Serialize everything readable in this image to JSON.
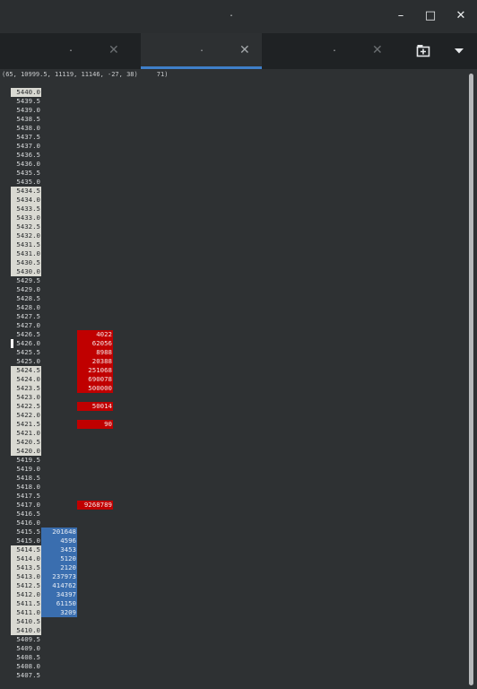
{
  "window": {
    "title": ".",
    "buttons": {
      "minimize": "–",
      "maximize": "□",
      "close": "✕"
    }
  },
  "tabs": [
    {
      "label": ".",
      "close": "✕",
      "active": false
    },
    {
      "label": ".",
      "close": "✕",
      "active": true
    },
    {
      "label": ".",
      "close": "✕",
      "active": false
    }
  ],
  "toolbar": {
    "new_tab_icon": "new-tab-icon",
    "menu_icon": "chevron-down-icon"
  },
  "status_text": "(65, 10999.5, 11119, 11146, -27, 38)     71)",
  "colors": {
    "accent": "#3f7fc9",
    "bid": "#3a6eaf",
    "ask": "#c00000",
    "highlight": "#d9d9d2"
  },
  "ladder": {
    "prices": [
      "5440.0",
      "5439.5",
      "5439.0",
      "5438.5",
      "5438.0",
      "5437.5",
      "5437.0",
      "5436.5",
      "5436.0",
      "5435.5",
      "5435.0",
      "5434.5",
      "5434.0",
      "5433.5",
      "5433.0",
      "5432.5",
      "5432.0",
      "5431.5",
      "5431.0",
      "5430.5",
      "5430.0",
      "5429.5",
      "5429.0",
      "5428.5",
      "5428.0",
      "5427.5",
      "5427.0",
      "5426.5",
      "5426.0",
      "5425.5",
      "5425.0",
      "5424.5",
      "5424.0",
      "5423.5",
      "5423.0",
      "5422.5",
      "5422.0",
      "5421.5",
      "5421.0",
      "5420.5",
      "5420.0",
      "5419.5",
      "5419.0",
      "5418.5",
      "5418.0",
      "5417.5",
      "5417.0",
      "5416.5",
      "5416.0",
      "5415.5",
      "5415.0",
      "5414.5",
      "5414.0",
      "5413.5",
      "5413.0",
      "5412.5",
      "5412.0",
      "5411.5",
      "5411.0",
      "5410.5",
      "5410.0",
      "5409.5",
      "5409.0",
      "5408.5",
      "5408.0",
      "5407.5"
    ],
    "highlighted": [
      "5440.0",
      "5434.5",
      "5434.0",
      "5433.5",
      "5433.0",
      "5432.5",
      "5432.0",
      "5431.5",
      "5431.0",
      "5430.5",
      "5430.0",
      "5424.5",
      "5424.0",
      "5423.5",
      "5423.0",
      "5422.5",
      "5422.0",
      "5421.5",
      "5421.0",
      "5420.5",
      "5420.0",
      "5414.5",
      "5414.0",
      "5413.5",
      "5413.0",
      "5412.5",
      "5412.0",
      "5411.5",
      "5411.0",
      "5410.5",
      "5410.0"
    ],
    "marker_price": "5426.0",
    "asks": [
      {
        "price": "5426.5",
        "size": "4022"
      },
      {
        "price": "5426.0",
        "size": "62056"
      },
      {
        "price": "5425.5",
        "size": "8988"
      },
      {
        "price": "5425.0",
        "size": "20388"
      },
      {
        "price": "5424.5",
        "size": "251068"
      },
      {
        "price": "5424.0",
        "size": "690078"
      },
      {
        "price": "5423.5",
        "size": "500000"
      },
      {
        "price": "5422.5",
        "size": "50014"
      },
      {
        "price": "5421.5",
        "size": "90"
      },
      {
        "price": "5417.0",
        "size": "9268789"
      }
    ],
    "bids": [
      {
        "price": "5415.5",
        "size": "201648"
      },
      {
        "price": "5415.0",
        "size": "4596"
      },
      {
        "price": "5414.5",
        "size": "3453"
      },
      {
        "price": "5414.0",
        "size": "5120"
      },
      {
        "price": "5413.5",
        "size": "2120"
      },
      {
        "price": "5413.0",
        "size": "237973"
      },
      {
        "price": "5412.5",
        "size": "414762"
      },
      {
        "price": "5412.0",
        "size": "34397"
      },
      {
        "price": "5411.5",
        "size": "61150"
      },
      {
        "price": "5411.0",
        "size": "3209"
      }
    ]
  }
}
